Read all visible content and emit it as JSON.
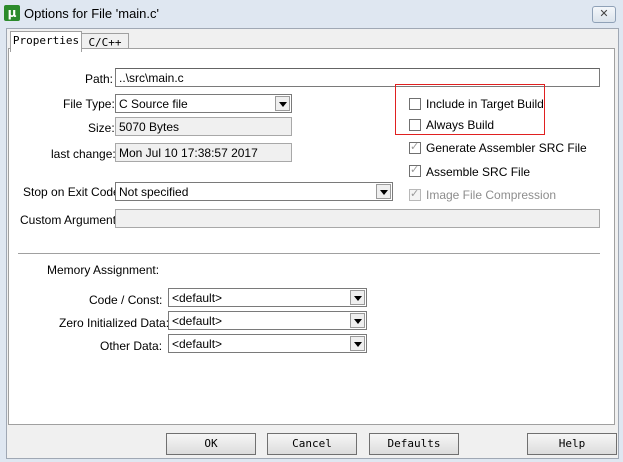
{
  "window": {
    "title": "Options for File 'main.c'",
    "app_icon": "µ"
  },
  "tabs": [
    {
      "label": "Properties"
    },
    {
      "label": "C/C++"
    }
  ],
  "fields": {
    "path": {
      "label": "Path:",
      "value": "..\\src\\main.c"
    },
    "file_type": {
      "label": "File Type:",
      "value": "C Source file"
    },
    "size": {
      "label": "Size:",
      "value": "5070 Bytes"
    },
    "last_change": {
      "label": "last change:",
      "value": "Mon Jul 10 17:38:57 2017"
    },
    "stop_on_exit": {
      "label": "Stop on Exit Code:",
      "value": "Not specified"
    },
    "custom_args": {
      "label": "Custom Arguments:",
      "value": ""
    }
  },
  "options": [
    {
      "label": "Include in Target Build",
      "checked": false,
      "enabled": true
    },
    {
      "label": "Always Build",
      "checked": false,
      "enabled": true
    },
    {
      "label": "Generate Assembler SRC File",
      "checked": true,
      "enabled": true
    },
    {
      "label": "Assemble SRC File",
      "checked": true,
      "enabled": true
    },
    {
      "label": "Image File Compression",
      "checked": true,
      "enabled": false
    }
  ],
  "memory": {
    "heading": "Memory Assignment:",
    "code_const": {
      "label": "Code / Const:",
      "value": "<default>"
    },
    "zero_init": {
      "label": "Zero Initialized Data:",
      "value": "<default>"
    },
    "other_data": {
      "label": "Other Data:",
      "value": "<default>"
    }
  },
  "buttons": {
    "ok": "OK",
    "cancel": "Cancel",
    "defaults": "Defaults",
    "help": "Help"
  },
  "colors": {
    "highlight_border": "#e02020"
  }
}
